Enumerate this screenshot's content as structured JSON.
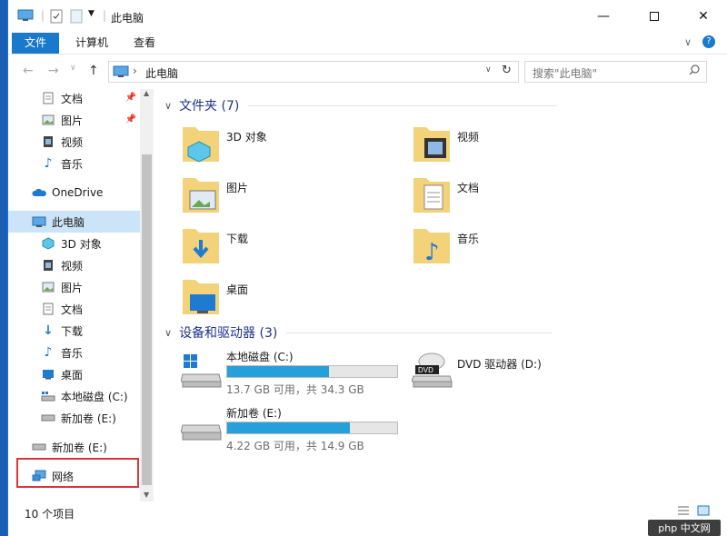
{
  "window": {
    "title": "此电脑"
  },
  "ribbon": {
    "tabs": [
      {
        "label": "文件"
      },
      {
        "label": "计算机"
      },
      {
        "label": "查看"
      }
    ]
  },
  "address": {
    "location": "此电脑",
    "search_placeholder": "搜索\"此电脑\""
  },
  "nav": {
    "quick": [
      {
        "label": "文档",
        "icon": "documents-icon"
      },
      {
        "label": "图片",
        "icon": "pictures-icon"
      },
      {
        "label": "视频",
        "icon": "videos-icon"
      },
      {
        "label": "音乐",
        "icon": "music-icon"
      }
    ],
    "onedrive": "OneDrive",
    "thispc": "此电脑",
    "thispc_items": [
      {
        "label": "3D 对象",
        "icon": "3d-objects-icon"
      },
      {
        "label": "视频",
        "icon": "videos-icon"
      },
      {
        "label": "图片",
        "icon": "pictures-icon"
      },
      {
        "label": "文档",
        "icon": "documents-icon"
      },
      {
        "label": "下载",
        "icon": "downloads-icon"
      },
      {
        "label": "音乐",
        "icon": "music-icon"
      },
      {
        "label": "桌面",
        "icon": "desktop-icon"
      },
      {
        "label": "本地磁盘 (C:)",
        "icon": "local-disk-icon"
      },
      {
        "label": "新加卷 (E:)",
        "icon": "drive-icon"
      }
    ],
    "newvol": "新加卷 (E:)",
    "network": "网络"
  },
  "content": {
    "folders_header": "文件夹 (7)",
    "folders": [
      {
        "label": "3D 对象"
      },
      {
        "label": "视频"
      },
      {
        "label": "图片"
      },
      {
        "label": "文档"
      },
      {
        "label": "下载"
      },
      {
        "label": "音乐"
      },
      {
        "label": "桌面"
      }
    ],
    "devices_header": "设备和驱动器 (3)",
    "drives": [
      {
        "label": "本地磁盘 (C:)",
        "free": "13.7 GB 可用，共 34.3 GB",
        "used_fraction": 0.6
      },
      {
        "label": "DVD 驱动器 (D:)"
      },
      {
        "label": "新加卷 (E:)",
        "free": "4.22 GB 可用，共 14.9 GB",
        "used_fraction": 0.72
      }
    ]
  },
  "status": {
    "count": "10 个项目"
  },
  "watermark": "php 中文网",
  "colors": {
    "accent": "#1979ca",
    "selected": "#cce4f7",
    "bar_fill": "#26a0da",
    "highlight": "#d9363e"
  }
}
